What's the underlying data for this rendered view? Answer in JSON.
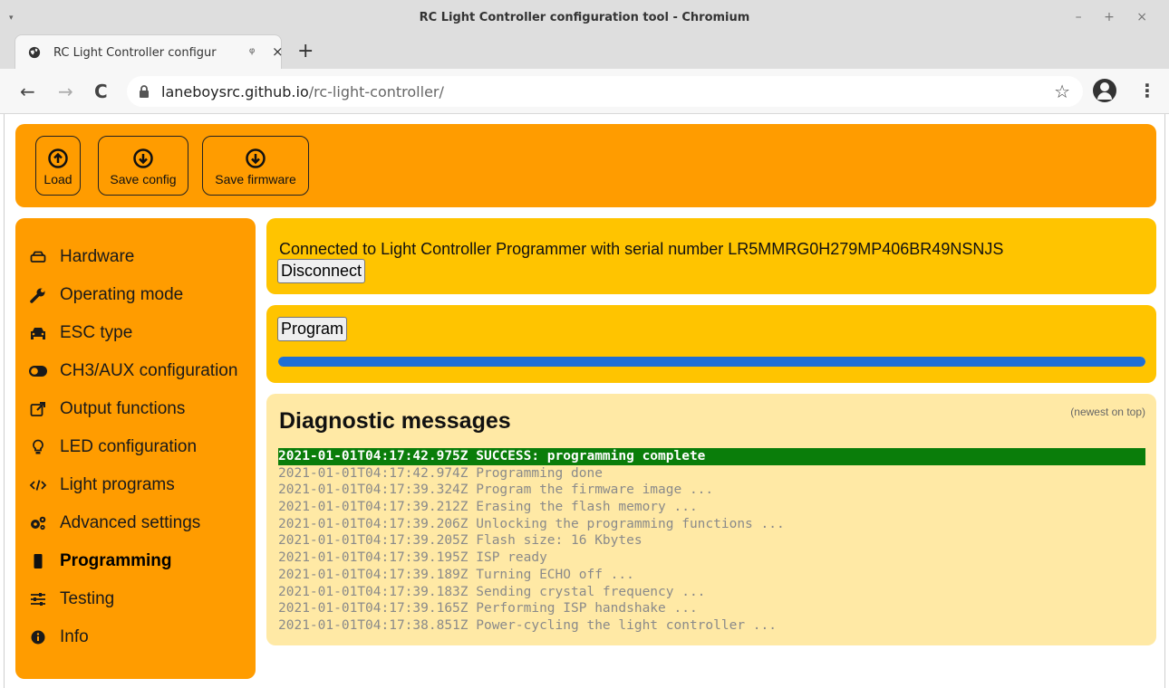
{
  "window": {
    "title": "RC Light Controller configuration tool - Chromium",
    "menu_glyph": "▾",
    "controls": "– + ×"
  },
  "browser": {
    "tab_title": "RC Light Controller configur",
    "tab_audio_glyph": "ᵠ",
    "tab_close_glyph": "×",
    "new_tab_glyph": "+",
    "back_glyph": "←",
    "forward_glyph": "→",
    "reload_glyph": "C",
    "url_host": "laneboysrc.github.io",
    "url_path": "/rc-light-controller/",
    "bookmark_glyph": "☆",
    "menu_glyph": "⋮"
  },
  "toolbar": {
    "load_label": "Load",
    "save_config_label": "Save config",
    "save_firmware_label": "Save firmware"
  },
  "sidebar": {
    "items": [
      {
        "label": "Hardware",
        "icon": "hdd-icon"
      },
      {
        "label": "Operating mode",
        "icon": "wrench-icon"
      },
      {
        "label": "ESC type",
        "icon": "car-icon"
      },
      {
        "label": "CH3/AUX configuration",
        "icon": "toggle-icon"
      },
      {
        "label": "Output functions",
        "icon": "external-link-icon"
      },
      {
        "label": "LED configuration",
        "icon": "lightbulb-icon"
      },
      {
        "label": "Light programs",
        "icon": "code-icon"
      },
      {
        "label": "Advanced settings",
        "icon": "cogs-icon"
      },
      {
        "label": "Programming",
        "icon": "chip-icon",
        "active": true
      },
      {
        "label": "Testing",
        "icon": "sliders-icon"
      },
      {
        "label": "Info",
        "icon": "info-icon"
      }
    ]
  },
  "connection": {
    "status_text": "Connected to Light Controller Programmer with serial number LR5MMRG0H279MP406BR49NSNJS",
    "disconnect_label": "Disconnect"
  },
  "programming": {
    "program_label": "Program",
    "progress": 1.0,
    "progress_color": "#1f6fd6"
  },
  "diagnostics": {
    "title": "Diagnostic messages",
    "note": "(newest on top)",
    "messages": [
      "2021-01-01T04:17:42.975Z SUCCESS: programming complete",
      "2021-01-01T04:17:42.974Z Programming done",
      "2021-01-01T04:17:39.324Z Program the firmware image ...",
      "2021-01-01T04:17:39.212Z Erasing the flash memory ...",
      "2021-01-01T04:17:39.206Z Unlocking the programming functions ...",
      "2021-01-01T04:17:39.205Z Flash size: 16 Kbytes",
      "2021-01-01T04:17:39.195Z ISP ready",
      "2021-01-01T04:17:39.189Z Turning ECHO off ...",
      "2021-01-01T04:17:39.183Z Sending crystal frequency ...",
      "2021-01-01T04:17:39.165Z Performing ISP handshake ...",
      "2021-01-01T04:17:38.851Z Power-cycling the light controller ..."
    ]
  },
  "colors": {
    "accent_orange": "#ff9c00",
    "panel_yellow": "#ffc400",
    "diag_background": "#ffe9a5",
    "success_green": "#0a7d0a"
  }
}
